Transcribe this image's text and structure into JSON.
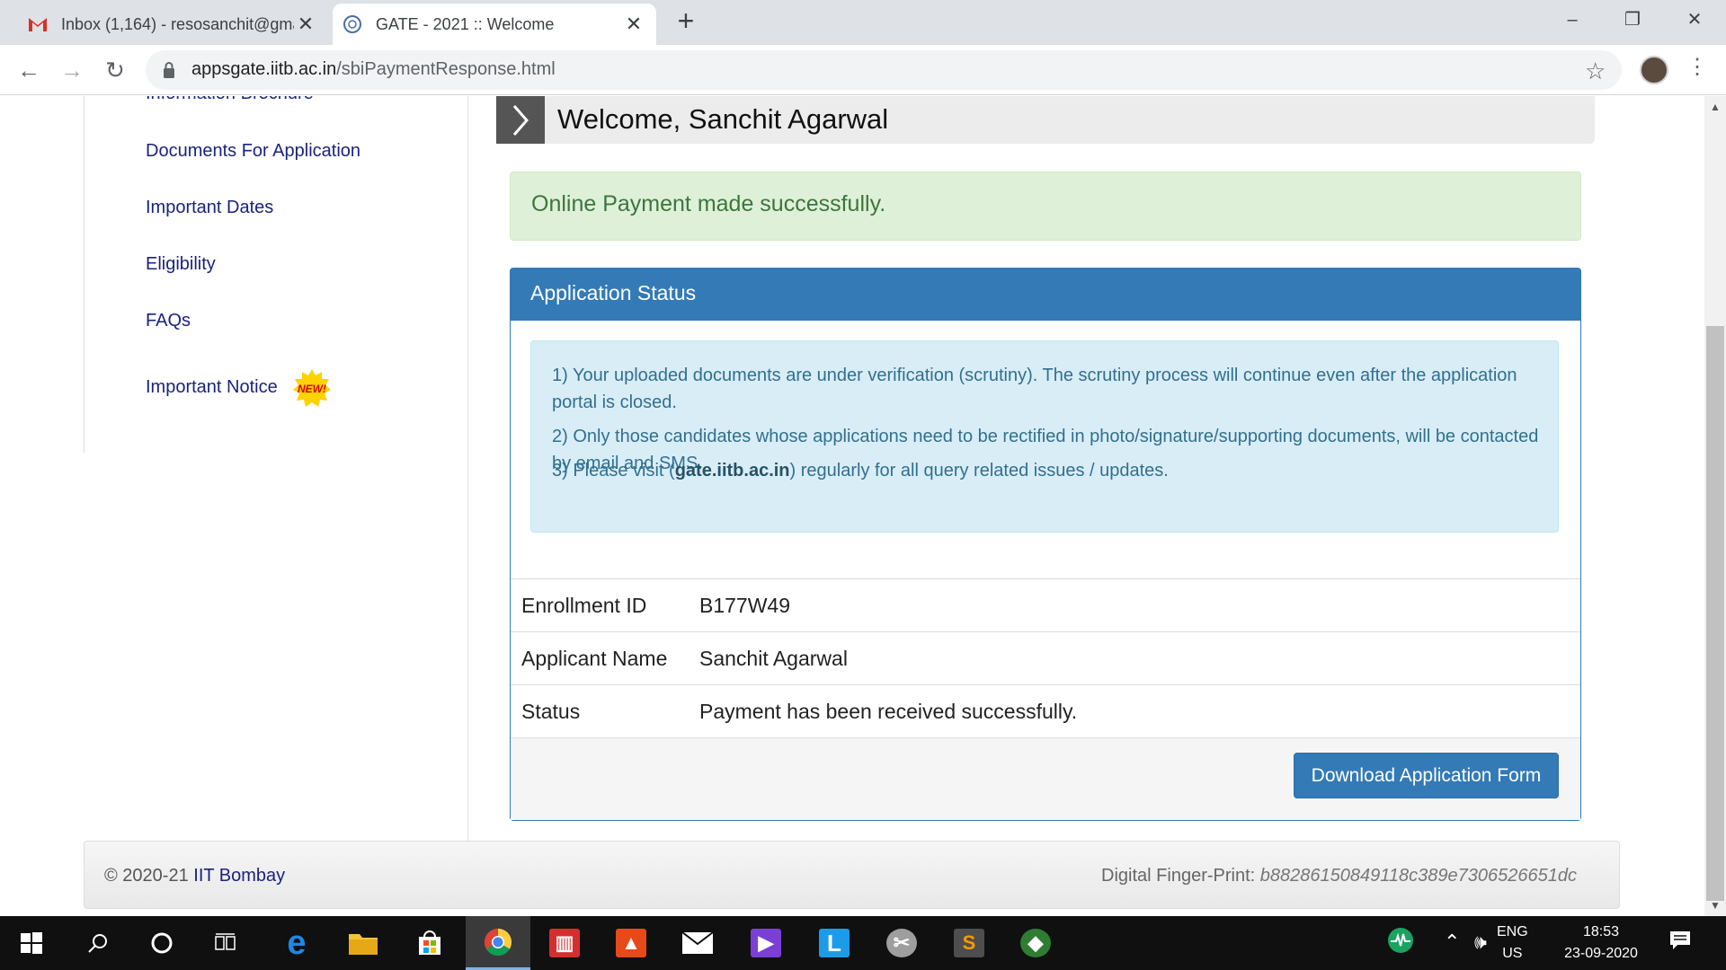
{
  "browser": {
    "tabs": [
      {
        "title": "Inbox (1,164) - resosanchit@gma",
        "icon": "gmail-icon",
        "active": false
      },
      {
        "title": "GATE - 2021 :: Welcome",
        "icon": "iitb-logo-icon",
        "active": true
      }
    ],
    "new_tab": "+",
    "url_host": "appsgate.iitb.ac.in",
    "url_path": "/sbiPaymentResponse.html",
    "window_controls": {
      "minimize": "–",
      "restore": "❐",
      "close": "✕"
    }
  },
  "sidebar": {
    "items": [
      {
        "label": "Information Brochure"
      },
      {
        "label": "Documents For Application"
      },
      {
        "label": "Important Dates"
      },
      {
        "label": "Eligibility"
      },
      {
        "label": "FAQs"
      },
      {
        "label": "Important Notice"
      }
    ],
    "new_badge": "NEW!"
  },
  "main": {
    "welcome": "Welcome, Sanchit Agarwal",
    "alert": "Online Payment made successfully.",
    "panel_title": "Application Status",
    "notes": {
      "n1": "1) Your uploaded documents are under verification (scrutiny). The scrutiny process will continue even after the application portal is closed.",
      "n2": "2) Only those candidates whose applications need to be rectified in photo/signature/supporting documents, will be contacted by email and SMS.",
      "n3_pre": "3) Please visit (",
      "n3_link": "gate.iitb.ac.in",
      "n3_post": ") regularly for all query related issues / updates."
    },
    "details": [
      {
        "label": "Enrollment ID",
        "value": "B177W49"
      },
      {
        "label": "Applicant Name",
        "value": "Sanchit Agarwal"
      },
      {
        "label": "Status",
        "value": "Payment has been received successfully."
      }
    ],
    "download_button": "Download Application Form"
  },
  "footer": {
    "copyright": "© 2020-21",
    "org": "IIT Bombay",
    "fingerprint_label": "Digital Finger-Print:",
    "fingerprint_value": "b88286150849118c389e7306526651dc"
  },
  "taskbar": {
    "lang_top": "ENG",
    "lang_bottom": "US",
    "time": "18:53",
    "date": "23-09-2020"
  },
  "colors": {
    "accent": "#337ab7",
    "success_bg": "#dff0d8",
    "success_text": "#3c763d",
    "info_bg": "#d9edf7",
    "info_text": "#31708f",
    "link": "#1a237e"
  }
}
